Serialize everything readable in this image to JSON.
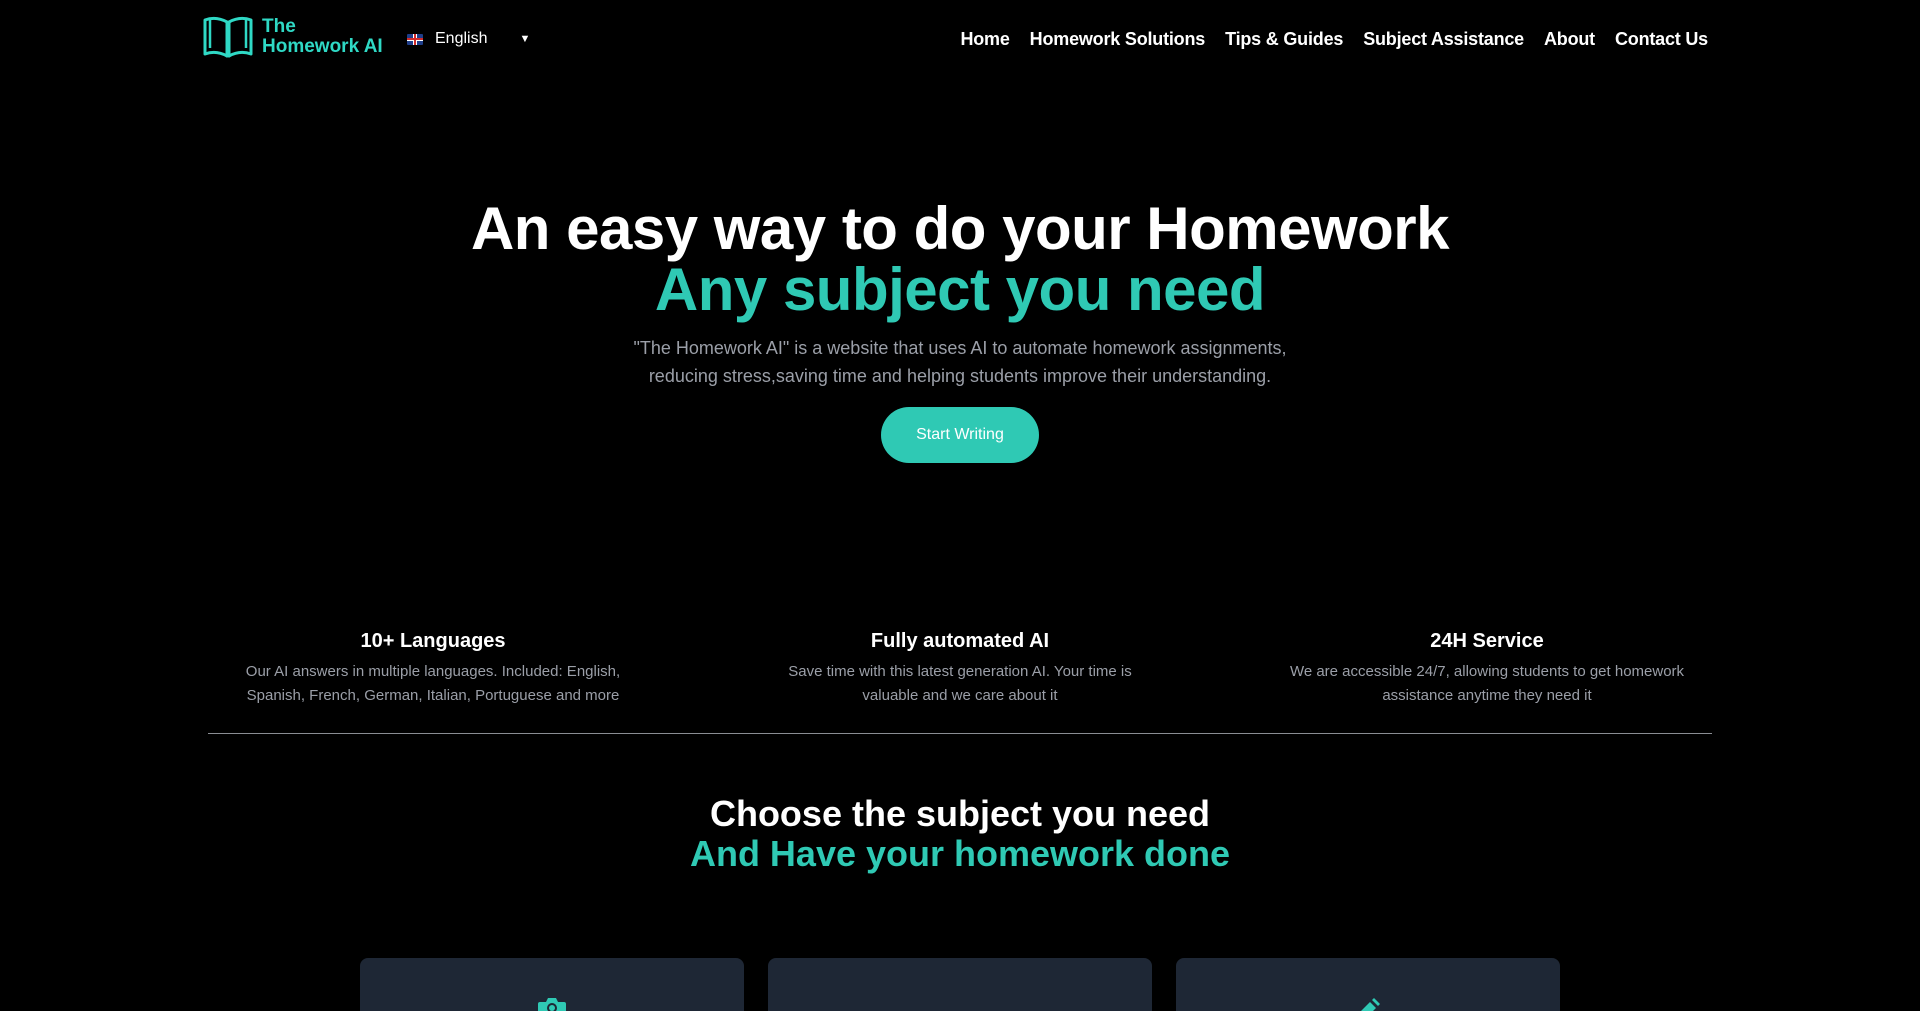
{
  "header": {
    "logo": {
      "line1": "The",
      "line2": "Homework AI",
      "icon": "open-book-icon"
    },
    "language": {
      "selected": "English",
      "flag_icon": "uk-flag-icon",
      "caret_icon": "caret-down-icon"
    },
    "nav": [
      {
        "label": "Home"
      },
      {
        "label": "Homework Solutions"
      },
      {
        "label": "Tips & Guides"
      },
      {
        "label": "Subject Assistance"
      },
      {
        "label": "About"
      },
      {
        "label": "Contact Us"
      }
    ]
  },
  "hero": {
    "title": "An easy way to do your Homework",
    "subtitle": "Any subject you need",
    "description_line1": "\"The Homework AI\" is a website that uses AI to automate homework assignments,",
    "description_line2": "reducing stress,saving time and helping students improve their understanding.",
    "button_label": "Start Writing"
  },
  "features": [
    {
      "title": "10+ Languages",
      "line1": "Our AI answers in multiple languages. Included: English,",
      "line2": "Spanish, French, German, Italian, Portuguese and more"
    },
    {
      "title": "Fully automated AI",
      "line1": "Save time with this latest generation AI. Your time is",
      "line2": "valuable and we care about it"
    },
    {
      "title": "24H Service",
      "line1": "We are accessible 24/7, allowing students to get homework",
      "line2": "assistance anytime they need it"
    }
  ],
  "subjects": {
    "title": "Choose the subject you need",
    "subtitle": "And Have your homework done",
    "cards": [
      {
        "icon": "camera-icon"
      },
      {
        "icon": ""
      },
      {
        "icon": "pencil-icon"
      }
    ]
  },
  "colors": {
    "accent": "#2fc9b4",
    "logo": "#2fd9c5",
    "background": "#000000",
    "card": "#1e2735",
    "muted_text": "#9b9fa8"
  }
}
